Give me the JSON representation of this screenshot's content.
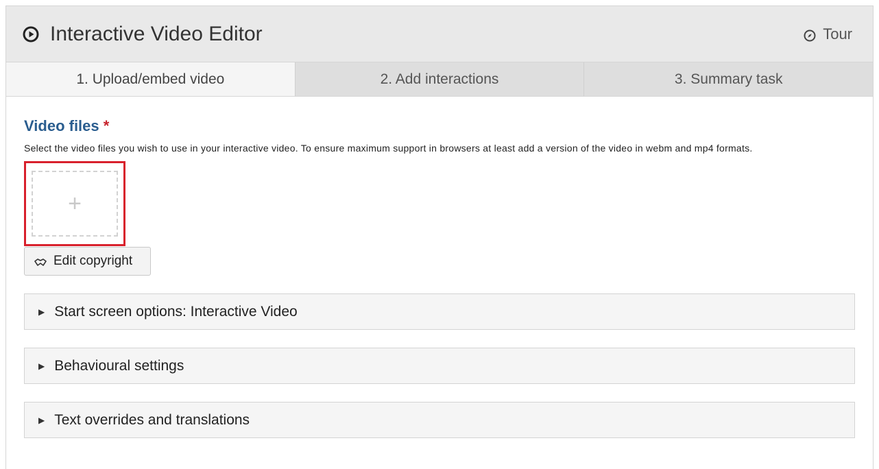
{
  "header": {
    "title": "Interactive Video Editor",
    "tour_label": "Tour"
  },
  "tabs": [
    {
      "label": "1. Upload/embed video",
      "active": true
    },
    {
      "label": "2. Add interactions",
      "active": false
    },
    {
      "label": "3. Summary task",
      "active": false
    }
  ],
  "video_files": {
    "label": "Video files",
    "required_mark": "*",
    "description": "Select the video files you wish to use in your interactive video. To ensure maximum support in browsers at least add a version of the video in webm and mp4 formats.",
    "add_glyph": "+",
    "edit_copyright_label": "Edit copyright"
  },
  "groups": [
    {
      "label": "Start screen options: Interactive Video"
    },
    {
      "label": "Behavioural settings"
    },
    {
      "label": "Text overrides and translations"
    }
  ],
  "icons": {
    "play": "play-circle-icon",
    "tour": "compass-icon",
    "copyright": "handshake-icon",
    "caret": "caret-right-icon"
  },
  "colors": {
    "label_blue": "#2a5d8f",
    "required_red": "#c7232c",
    "highlight_red": "#d8202c"
  }
}
